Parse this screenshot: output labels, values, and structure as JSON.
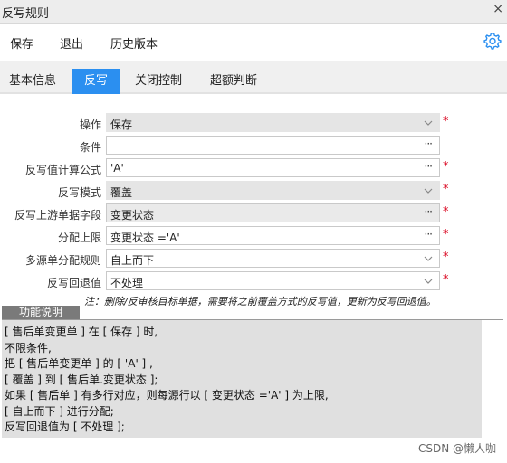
{
  "window": {
    "title": "反写规则",
    "close_glyph": "×"
  },
  "toolbar": {
    "save": "保存",
    "exit": "退出",
    "history": "历史版本",
    "settings_icon": "gear-icon"
  },
  "tabs": [
    {
      "label": "基本信息",
      "active": false
    },
    {
      "label": "反写",
      "active": true
    },
    {
      "label": "关闭控制",
      "active": false
    },
    {
      "label": "超额判断",
      "active": false
    }
  ],
  "form": {
    "operation": {
      "label": "操作",
      "value": "保存",
      "required": true,
      "kind": "select"
    },
    "condition": {
      "label": "条件",
      "value": "",
      "required": false,
      "kind": "lookup"
    },
    "formula": {
      "label": "反写值计算公式",
      "value": "'A'",
      "required": true,
      "kind": "lookup"
    },
    "mode": {
      "label": "反写模式",
      "value": "覆盖",
      "required": true,
      "kind": "select"
    },
    "upstream_field": {
      "label": "反写上游单据字段",
      "value": "变更状态",
      "required": true,
      "kind": "lookup"
    },
    "limit": {
      "label": "分配上限",
      "value": "变更状态 ='A'",
      "required": true,
      "kind": "lookup"
    },
    "multi_source_rule": {
      "label": "多源单分配规则",
      "value": "自上而下",
      "required": true,
      "kind": "select"
    },
    "rollback": {
      "label": "反写回退值",
      "value": "不处理",
      "required": true,
      "kind": "select"
    },
    "required_mark": "*",
    "lookup_glyph": "···"
  },
  "note": "注：删除/反审核目标单据，需要将之前覆盖方式的反写值，更新为反写回退值。",
  "description": {
    "tab_label": "功能说明",
    "lines": [
      "[ 售后单变更单 ] 在 [ 保存 ] 时,",
      "不限条件,",
      "把 [ 售后单变更单 ] 的 [ 'A' ] ,",
      "[ 覆盖 ] 到 [ 售后单.变更状态 ];",
      "如果 [ 售后单 ] 有多行对应，则每源行以 [ 变更状态 ='A' ] 为上限,",
      "[ 自上而下 ] 进行分配;",
      "反写回退值为 [ 不处理 ];"
    ]
  },
  "watermark": "CSDN @懒人咖",
  "colors": {
    "accent": "#2b8ff0",
    "required": "#d9001b"
  }
}
